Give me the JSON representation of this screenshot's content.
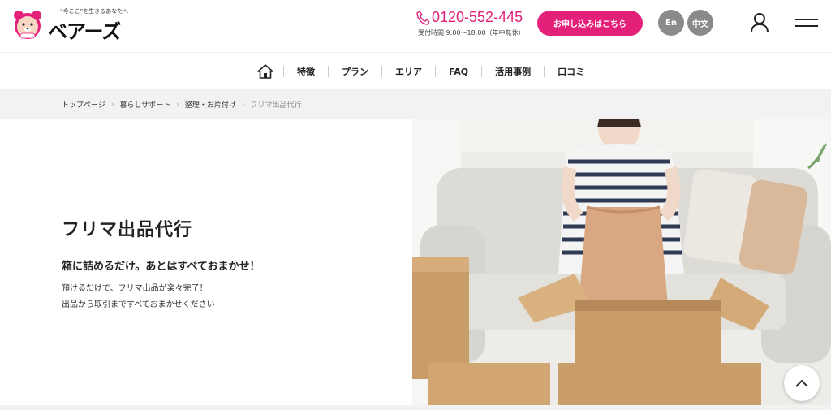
{
  "header": {
    "logo": {
      "tagline": "“今ここ”を生きるあなたへ",
      "name": "ベアーズ",
      "mascot_icon": "bear-mascot-icon"
    },
    "phone": {
      "number": "0120-552-445",
      "hours": "受付時間 9:00〜18:00（年中無休）",
      "icon": "phone-icon"
    },
    "apply_label": "お申し込みはこちら",
    "lang_en": "En",
    "lang_zh": "中文",
    "user_icon": "user-icon",
    "menu_icon": "hamburger-menu-icon"
  },
  "nav": {
    "home_icon": "home-icon",
    "items": [
      "特徴",
      "プラン",
      "エリア",
      "FAQ",
      "活用事例",
      "口コミ"
    ]
  },
  "breadcrumb": [
    "トップページ",
    "暮らしサポート",
    "整理・お片付け",
    "フリマ出品代行"
  ],
  "hero": {
    "title": "フリマ出品代行",
    "subtitle": "箱に詰めるだけ。あとはすべておまかせ！",
    "desc_line1": "預けるだけで、フリマ出品が楽々完了！",
    "desc_line2": "出品から取引まですべておまかせください"
  },
  "scroll_top_icon": "chevron-up-icon",
  "colors": {
    "brand_pink": "#e3207a",
    "lang_gray": "#8a8a8a",
    "breadcrumb_bg": "#f2f2f2"
  }
}
